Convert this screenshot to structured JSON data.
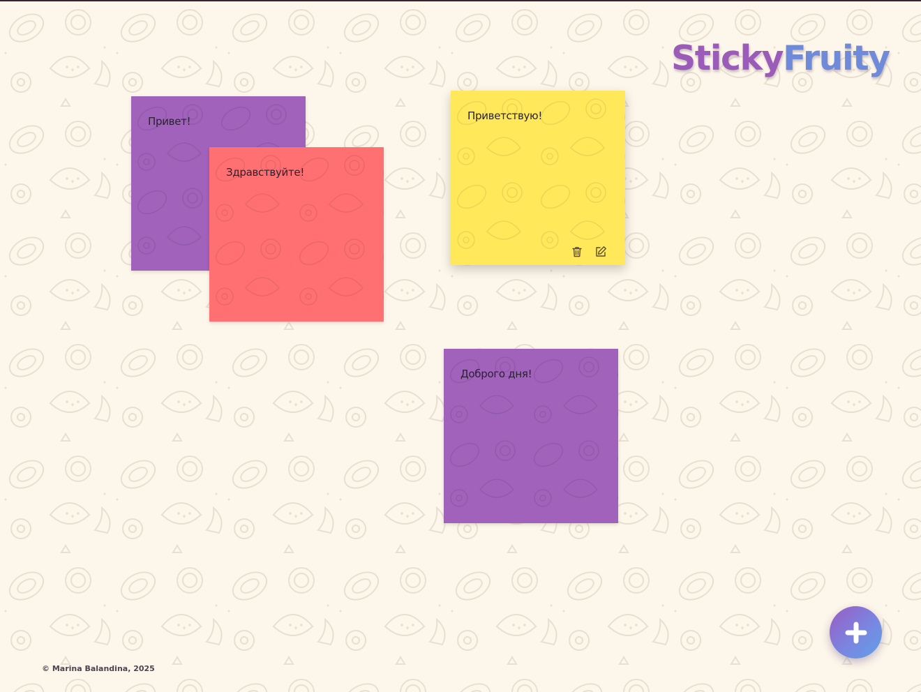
{
  "app": {
    "logo_part1": "Sticky",
    "logo_part2": "Fruity",
    "logo_colors": [
      "#9b5bb8",
      "#6f8ad8"
    ],
    "background_color": "#fdf6ea"
  },
  "notes": [
    {
      "text": "Привет!",
      "color": "#a062bb"
    },
    {
      "text": "Здравствуйте!",
      "color": "#ff7072"
    },
    {
      "text": "Приветствую!",
      "color": "#ffe95a",
      "actions": [
        "trash-icon",
        "edit-icon"
      ]
    },
    {
      "text": "Доброго дня!",
      "color": "#a062bb"
    }
  ],
  "add_button": {
    "icon": "plus-icon"
  },
  "footer": {
    "copyright": "© Marina Balandina, 2025"
  }
}
